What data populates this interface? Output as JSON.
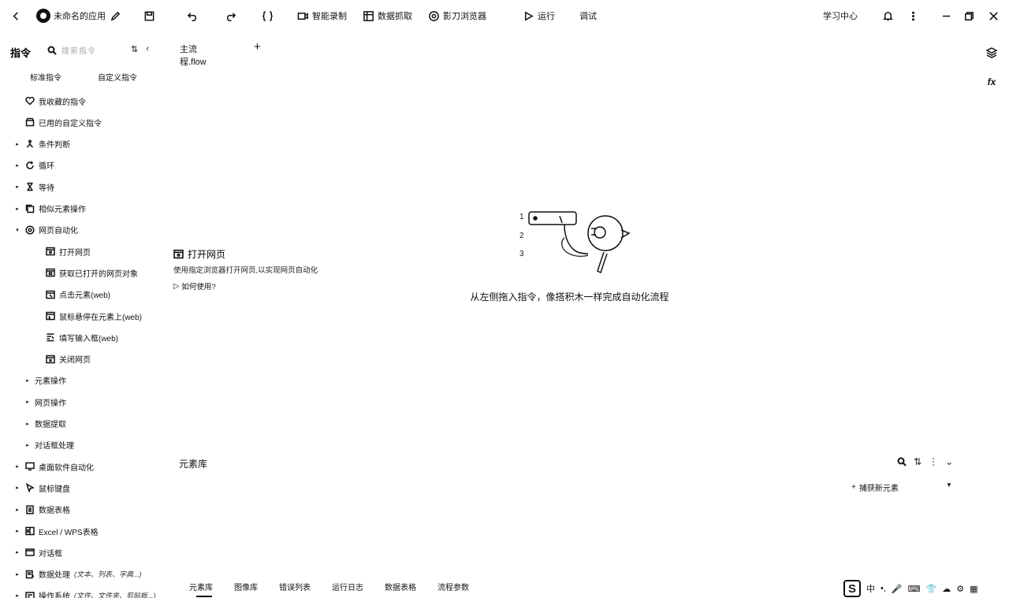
{
  "header": {
    "app_name": "未命名的应用",
    "edit_icon": "edit-icon",
    "buttons": {
      "smart_record": "智能录制",
      "data_scrape": "数据抓取",
      "browser": "影刀浏览器",
      "run": "运行",
      "debug": "调试",
      "learning_center": "学习中心"
    }
  },
  "sidebar": {
    "title": "指令",
    "search_placeholder": "搜索指令",
    "tabs": [
      "标准指令",
      "自定义指令"
    ],
    "items": [
      {
        "label": "我收藏的指令",
        "icon": "heart-icon",
        "level": 0,
        "caret": ""
      },
      {
        "label": "已用的自定义指令",
        "icon": "box-icon",
        "level": 0,
        "caret": ""
      },
      {
        "label": "条件判断",
        "icon": "branch-icon",
        "level": 0,
        "caret": "▸"
      },
      {
        "label": "循环",
        "icon": "loop-icon",
        "level": 0,
        "caret": "▸"
      },
      {
        "label": "等待",
        "icon": "hourglass-icon",
        "level": 0,
        "caret": "▸"
      },
      {
        "label": "相似元素操作",
        "icon": "copy-icon",
        "level": 0,
        "caret": "▸"
      },
      {
        "label": "网页自动化",
        "icon": "browser-icon",
        "level": 0,
        "caret": "▾"
      },
      {
        "label": "打开网页",
        "icon": "web-open-icon",
        "level": 2,
        "caret": ""
      },
      {
        "label": "获取已打开的网页对象",
        "icon": "web-object-icon",
        "level": 2,
        "caret": ""
      },
      {
        "label": "点击元素(web)",
        "icon": "web-click-icon",
        "level": 2,
        "caret": ""
      },
      {
        "label": "鼠标悬停在元素上(web)",
        "icon": "web-hover-icon",
        "level": 2,
        "caret": ""
      },
      {
        "label": "填写输入框(web)",
        "icon": "web-input-icon",
        "level": 2,
        "caret": ""
      },
      {
        "label": "关闭网页",
        "icon": "web-close-icon",
        "level": 2,
        "caret": ""
      },
      {
        "label": "元素操作",
        "icon": "",
        "level": 1,
        "caret": "▸"
      },
      {
        "label": "网页操作",
        "icon": "",
        "level": 1,
        "caret": "▸"
      },
      {
        "label": "数据提取",
        "icon": "",
        "level": 1,
        "caret": "▸"
      },
      {
        "label": "对话框处理",
        "icon": "",
        "level": 1,
        "caret": "▸"
      },
      {
        "label": "桌面软件自动化",
        "icon": "desktop-icon",
        "level": 0,
        "caret": "▸"
      },
      {
        "label": "鼠标键盘",
        "icon": "cursor-icon",
        "level": 0,
        "caret": "▸"
      },
      {
        "label": "数据表格",
        "icon": "table-icon",
        "level": 0,
        "caret": "▸"
      },
      {
        "label": "Excel / WPS表格",
        "icon": "excel-icon",
        "level": 0,
        "caret": "▸"
      },
      {
        "label": "对话框",
        "icon": "dialog-icon",
        "level": 0,
        "caret": "▸"
      },
      {
        "label": "数据处理",
        "hint": "(文本、列表、字典...)",
        "icon": "data-process-icon",
        "level": 0,
        "caret": "▸"
      },
      {
        "label": "操作系统",
        "hint": "(文件、文件夹、剪贴板...)",
        "icon": "os-icon",
        "level": 0,
        "caret": "▸"
      }
    ]
  },
  "editor": {
    "tab_label": "主流程.flow",
    "add_tab": "+",
    "empty_numbers": [
      "1",
      "2",
      "3"
    ],
    "empty_message": "从左侧拖入指令，像搭积木一样完成自动化流程"
  },
  "tooltip": {
    "title": "打开网页",
    "description": "使用指定浏览器打开网页,以实现网页自动化",
    "help_link": "如何使用?"
  },
  "right_rail": {
    "layers_icon": "layers-icon",
    "fx_label": "fx"
  },
  "library": {
    "title": "元素库",
    "capture_button": "捕获新元素",
    "bottom_tabs": [
      "元素库",
      "图像库",
      "错误列表",
      "运行日志",
      "数据表格",
      "流程参数"
    ],
    "active_tab": 0
  },
  "ime": {
    "logo": "S",
    "items": [
      "中",
      "•,",
      "🎤",
      "⌨",
      "👕",
      "☁",
      "⚙",
      "▦"
    ]
  }
}
